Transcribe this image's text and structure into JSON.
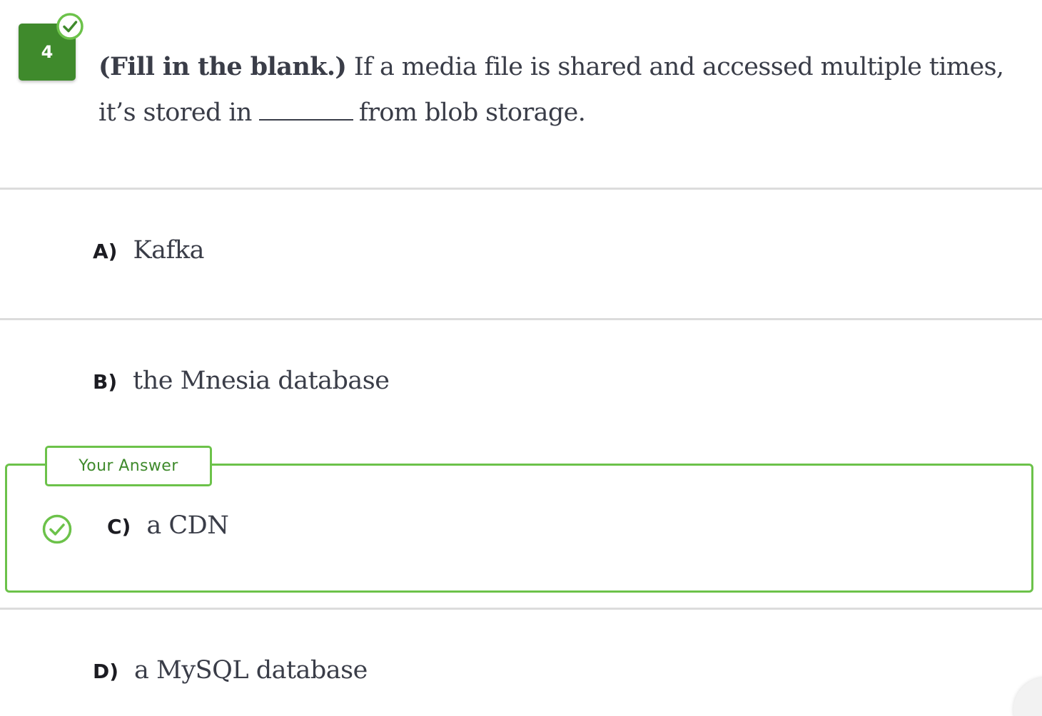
{
  "question": {
    "number": "4",
    "tag": "(Fill in the blank.)",
    "text_before": "If a media file is shared and accessed multiple times, it’s stored in",
    "text_after": "from blob storage."
  },
  "options": [
    {
      "letter": "A)",
      "text": "Kafka"
    },
    {
      "letter": "B)",
      "text": "the Mnesia database"
    },
    {
      "letter": "C)",
      "text": "a CDN"
    },
    {
      "letter": "D)",
      "text": "a MySQL database"
    }
  ],
  "your_answer": {
    "label": "Your Answer",
    "option_index": 2,
    "status": "correct"
  },
  "icons": {
    "question_status": "check-circle-icon",
    "answer_status": "check-circle-icon"
  },
  "colors": {
    "correct_green": "#6cc24a",
    "badge_green": "#3f8a2c",
    "text": "#3a3d48",
    "divider": "#dcdcdc"
  }
}
